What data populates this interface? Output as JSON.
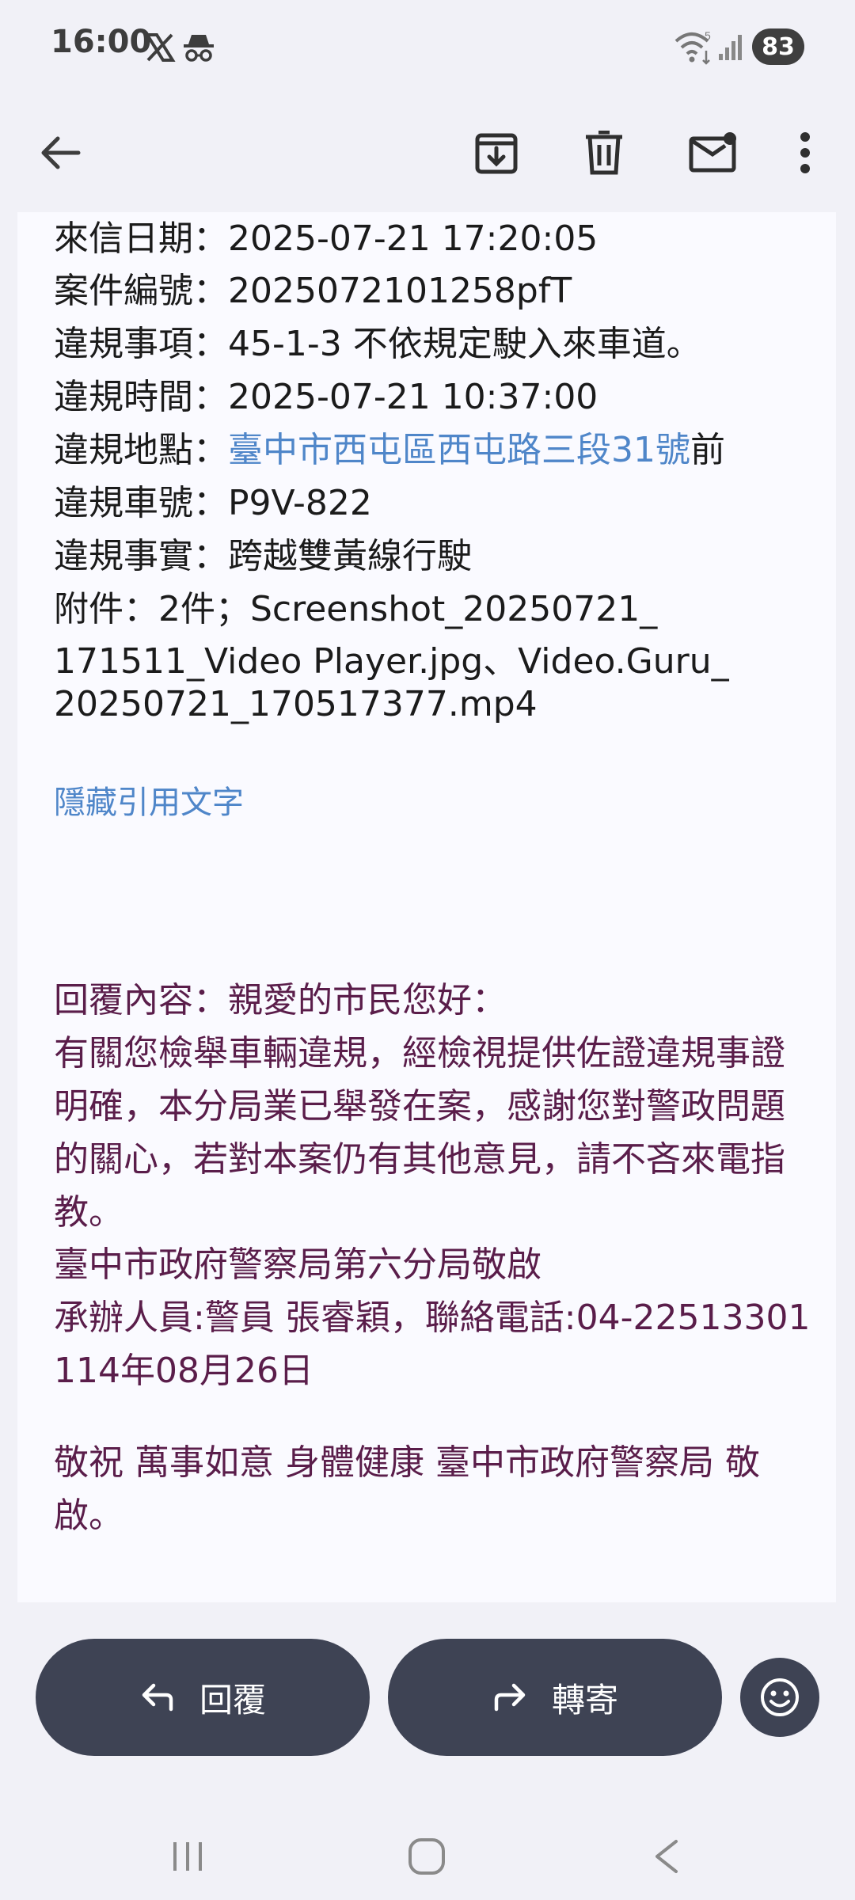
{
  "status_bar": {
    "time": "16:00",
    "battery": "83",
    "icons": [
      "x-icon",
      "incognito-icon",
      "wifi-icon",
      "signal-icon"
    ]
  },
  "app_bar": {
    "icons": [
      "back-arrow-icon",
      "archive-icon",
      "delete-icon",
      "mark-unread-icon",
      "more-options-icon"
    ]
  },
  "email": {
    "received_date": "來信日期：2025-07-21 17:20:05",
    "case_number": "案件編號：2025072101258pfT",
    "violation_item": "違規事項：45-1-3 不依規定駛入來車道。",
    "violation_time": "違規時間：2025-07-21 10:37:00",
    "location_label": "違規地點：",
    "location_link": "臺中市西屯區西屯路三段31號",
    "location_suffix": "前",
    "plate": "違規車號：P9V-822",
    "facts": "違規事實：跨越雙黃線行駛",
    "attachment_line1": "附件：2件；Screenshot_20250721_",
    "attachment_line2": "171511_Video Player.jpg、Video.Guru_",
    "attachment_line3": "20250721_170517377.mp4",
    "hide_quote": "隱藏引用文字",
    "reply_title": "回覆內容：親愛的市民您好：",
    "reply_l1": "有關您檢舉車輛違規，經檢視提供佐證違規事證",
    "reply_l2": "明確，本分局業已舉發在案，感謝您對警政問題",
    "reply_l3": "的關心，若對本案仍有其他意見，請不吝來電指",
    "reply_l4": "教。",
    "reply_l5": "臺中市政府警察局第六分局敬啟",
    "reply_l6": "承辦人員:警員 張睿穎，聯絡電話:04-22513301",
    "reply_l7": "114年08月26日",
    "closing_l1": "敬祝 萬事如意 身體健康 臺中市政府警察局 敬",
    "closing_l2": "啟。"
  },
  "actions": {
    "reply_label": "回覆",
    "forward_label": "轉寄"
  },
  "colors": {
    "link": "#4f86c9",
    "reply_text": "#5a1d4a",
    "button_bg": "#3e4354"
  }
}
